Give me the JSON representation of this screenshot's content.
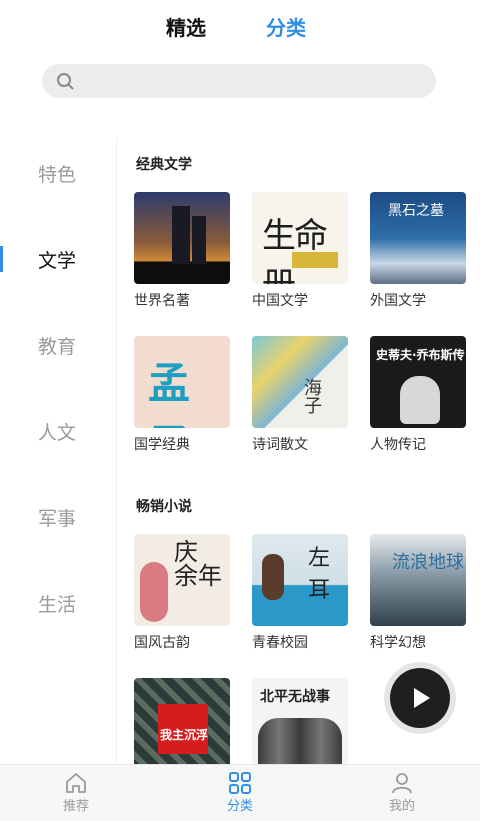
{
  "top_tabs": {
    "featured": "精选",
    "category": "分类"
  },
  "sidebar": {
    "items": [
      "特色",
      "文学",
      "教育",
      "人文",
      "军事",
      "生活"
    ]
  },
  "sections": [
    {
      "title": "经典文学",
      "books": [
        "世界名著",
        "中国文学",
        "外国文学",
        "国学经典",
        "诗词散文",
        "人物传记"
      ]
    },
    {
      "title": "畅销小说",
      "books": [
        "国风古韵",
        "青春校园",
        "科学幻想"
      ]
    }
  ],
  "bottom_nav": {
    "recommend": "推荐",
    "category": "分类",
    "mine": "我的"
  },
  "colors": {
    "accent": "#2f8fe6"
  }
}
